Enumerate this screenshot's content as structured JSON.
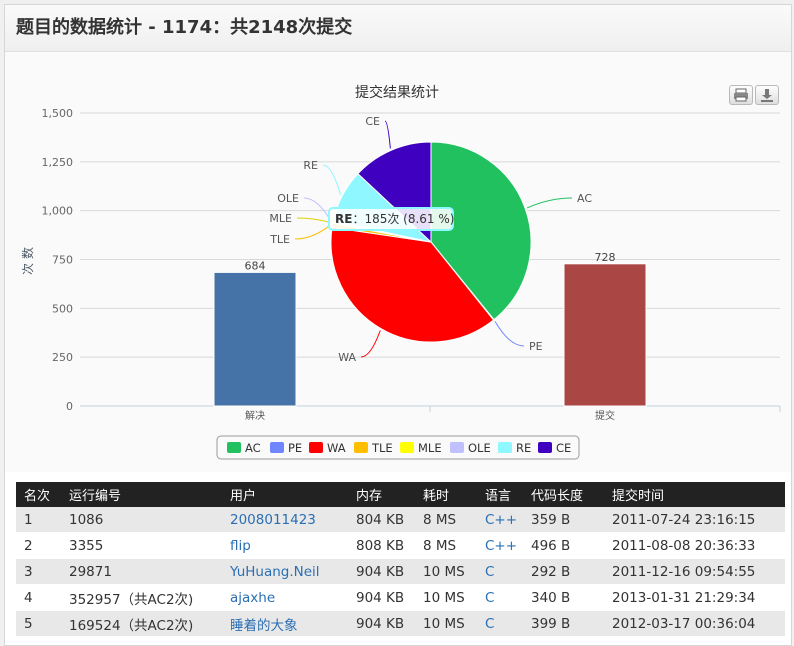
{
  "page_title": "题目的数据统计 - 1174：共2148次提交",
  "colors": {
    "accent_link": "#2a6fb4",
    "header_bg": "#222222"
  },
  "toolbar_icons": [
    "print-icon",
    "download-icon"
  ],
  "chart_data": [
    {
      "type": "bar",
      "categories": [
        "解决",
        "提交"
      ],
      "values": [
        684,
        728
      ],
      "colors": [
        "#4572A7",
        "#AA4643"
      ],
      "ylabel": "次数",
      "ylim": [
        0,
        1500
      ],
      "yticks": [
        "0",
        "250",
        "500",
        "750",
        "1,000",
        "1,250",
        "1,500"
      ],
      "grid": true
    },
    {
      "type": "pie",
      "title": "提交结果统计",
      "slices": [
        {
          "label": "AC",
          "value": 841,
          "color": "#21c15f"
        },
        {
          "label": "PE",
          "value": 2,
          "color": "#6f86ff"
        },
        {
          "label": "WA",
          "value": 818,
          "color": "#ff0000"
        },
        {
          "label": "TLE",
          "value": 14,
          "color": "#ffbf00"
        },
        {
          "label": "MLE",
          "value": 3,
          "color": "#ffff00"
        },
        {
          "label": "OLE",
          "value": 5,
          "color": "#c0c0ff"
        },
        {
          "label": "RE",
          "value": 185,
          "color": "#8ff7ff"
        },
        {
          "label": "CE",
          "value": 280,
          "color": "#4000c0"
        }
      ],
      "tooltip": {
        "label": "RE",
        "text": "：185次 (8.61 %)"
      },
      "legend_position": "bottom"
    }
  ],
  "table": {
    "headers": [
      "名次",
      "运行编号",
      "用户",
      "内存",
      "耗时",
      "语言",
      "代码长度",
      "提交时间"
    ],
    "rows": [
      [
        "1",
        "1086",
        "2008011423",
        "804 KB",
        "8 MS",
        "C++",
        "359 B",
        "2011-07-24 23:16:15"
      ],
      [
        "2",
        "3355",
        "flip",
        "808 KB",
        "8 MS",
        "C++",
        "496 B",
        "2011-08-08 20:36:33"
      ],
      [
        "3",
        "29871",
        "YuHuang.Neil",
        "904 KB",
        "10 MS",
        "C",
        "292 B",
        "2011-12-16 09:54:55"
      ],
      [
        "4",
        "352957（共AC2次)",
        "ajaxhe",
        "904 KB",
        "10 MS",
        "C",
        "340 B",
        "2013-01-31 21:29:34"
      ],
      [
        "5",
        "169524（共AC2次)",
        "睡着的大象",
        "904 KB",
        "10 MS",
        "C",
        "399 B",
        "2012-03-17 00:36:04"
      ]
    ]
  }
}
